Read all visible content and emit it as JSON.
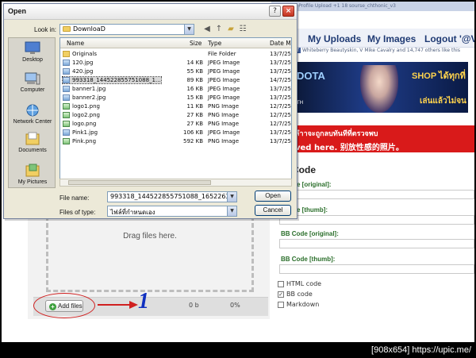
{
  "browser": {
    "top_strip": "Home   My Profile   Upload   +1 18   sourse_chthonic_v3",
    "nav": {
      "uploads": "My Uploads",
      "images": "My Images",
      "logout": "Logout '@V"
    },
    "fb_line": "Whiteberry Beautyskin, V Mike Cavalry and 14,747 others like this",
    "banner": {
      "left": "DOTA",
      "right": "SHOP ได้ทุกที่",
      "bottom": "เล่นแล้วไม่จน",
      "th": ".TH"
    },
    "red_line1": "ลำาจะถูกลบทันทีที่ตรวจพบ",
    "red_line2": "ved here. 别放性感的照片。",
    "code_title": "Code",
    "code_labels": [
      ". Code [original]:",
      ". Code [thumb]:",
      "BB Code [original]:",
      "BB Code [thumb]:"
    ],
    "options": [
      {
        "label": "HTML code",
        "checked": false
      },
      {
        "label": "BB code",
        "checked": true
      },
      {
        "label": "Markdown",
        "checked": false
      }
    ],
    "uploader": {
      "drag_text": "Drag files here.",
      "add_button": "Add files",
      "size": "0 b",
      "percent": "0%"
    },
    "annotation": "1"
  },
  "dialog": {
    "title": "Open",
    "look_in_label": "Look in:",
    "look_in_value": "DownloaD",
    "places": [
      "Desktop",
      "Computer",
      "Network Center",
      "Documents",
      "My Pictures"
    ],
    "columns": {
      "name": "Name",
      "size": "Size",
      "type": "Type",
      "date": "Date Mo"
    },
    "files": [
      {
        "name": "Originals",
        "size": "",
        "type": "File Folder",
        "date": "13/7/255",
        "icon": "folder-icon"
      },
      {
        "name": "120.jpg",
        "size": "14 KB",
        "type": "JPEG Image",
        "date": "13/7/255",
        "icon": "jpeg-icon"
      },
      {
        "name": "420.jpg",
        "size": "55 KB",
        "type": "JPEG Image",
        "date": "13/7/255",
        "icon": "jpeg-icon"
      },
      {
        "name": "993318_144522855751088_1...",
        "size": "89 KB",
        "type": "JPEG Image",
        "date": "14/7/255",
        "icon": "jpeg-icon"
      },
      {
        "name": "banner1.jpg",
        "size": "16 KB",
        "type": "JPEG Image",
        "date": "13/7/255",
        "icon": "jpeg-icon"
      },
      {
        "name": "banner2.jpg",
        "size": "15 KB",
        "type": "JPEG Image",
        "date": "13/7/255",
        "icon": "jpeg-icon"
      },
      {
        "name": "logo1.png",
        "size": "11 KB",
        "type": "PNG Image",
        "date": "12/7/255",
        "icon": "png-icon"
      },
      {
        "name": "logo2.png",
        "size": "27 KB",
        "type": "PNG Image",
        "date": "12/7/255",
        "icon": "png-icon"
      },
      {
        "name": "logo.png",
        "size": "27 KB",
        "type": "PNG Image",
        "date": "12/7/255",
        "icon": "png-icon"
      },
      {
        "name": "Pink1.jpg",
        "size": "106 KB",
        "type": "JPEG Image",
        "date": "13/7/255",
        "icon": "jpeg-icon"
      },
      {
        "name": "Pink.png",
        "size": "592 KB",
        "type": "PNG Image",
        "date": "13/7/255",
        "icon": "png-icon"
      }
    ],
    "selected_file": "993318_144522855751088_1...",
    "file_name_label": "File name:",
    "file_name_value": "993318_144522855751088_1652263758_n.jpg",
    "file_type_label": "Files of type:",
    "file_type_value": "ไฟล์ที่กำหนดเอง",
    "open_button": "Open",
    "cancel_button": "Cancel"
  },
  "footer_caption": "[908x654] https://upic.me/"
}
